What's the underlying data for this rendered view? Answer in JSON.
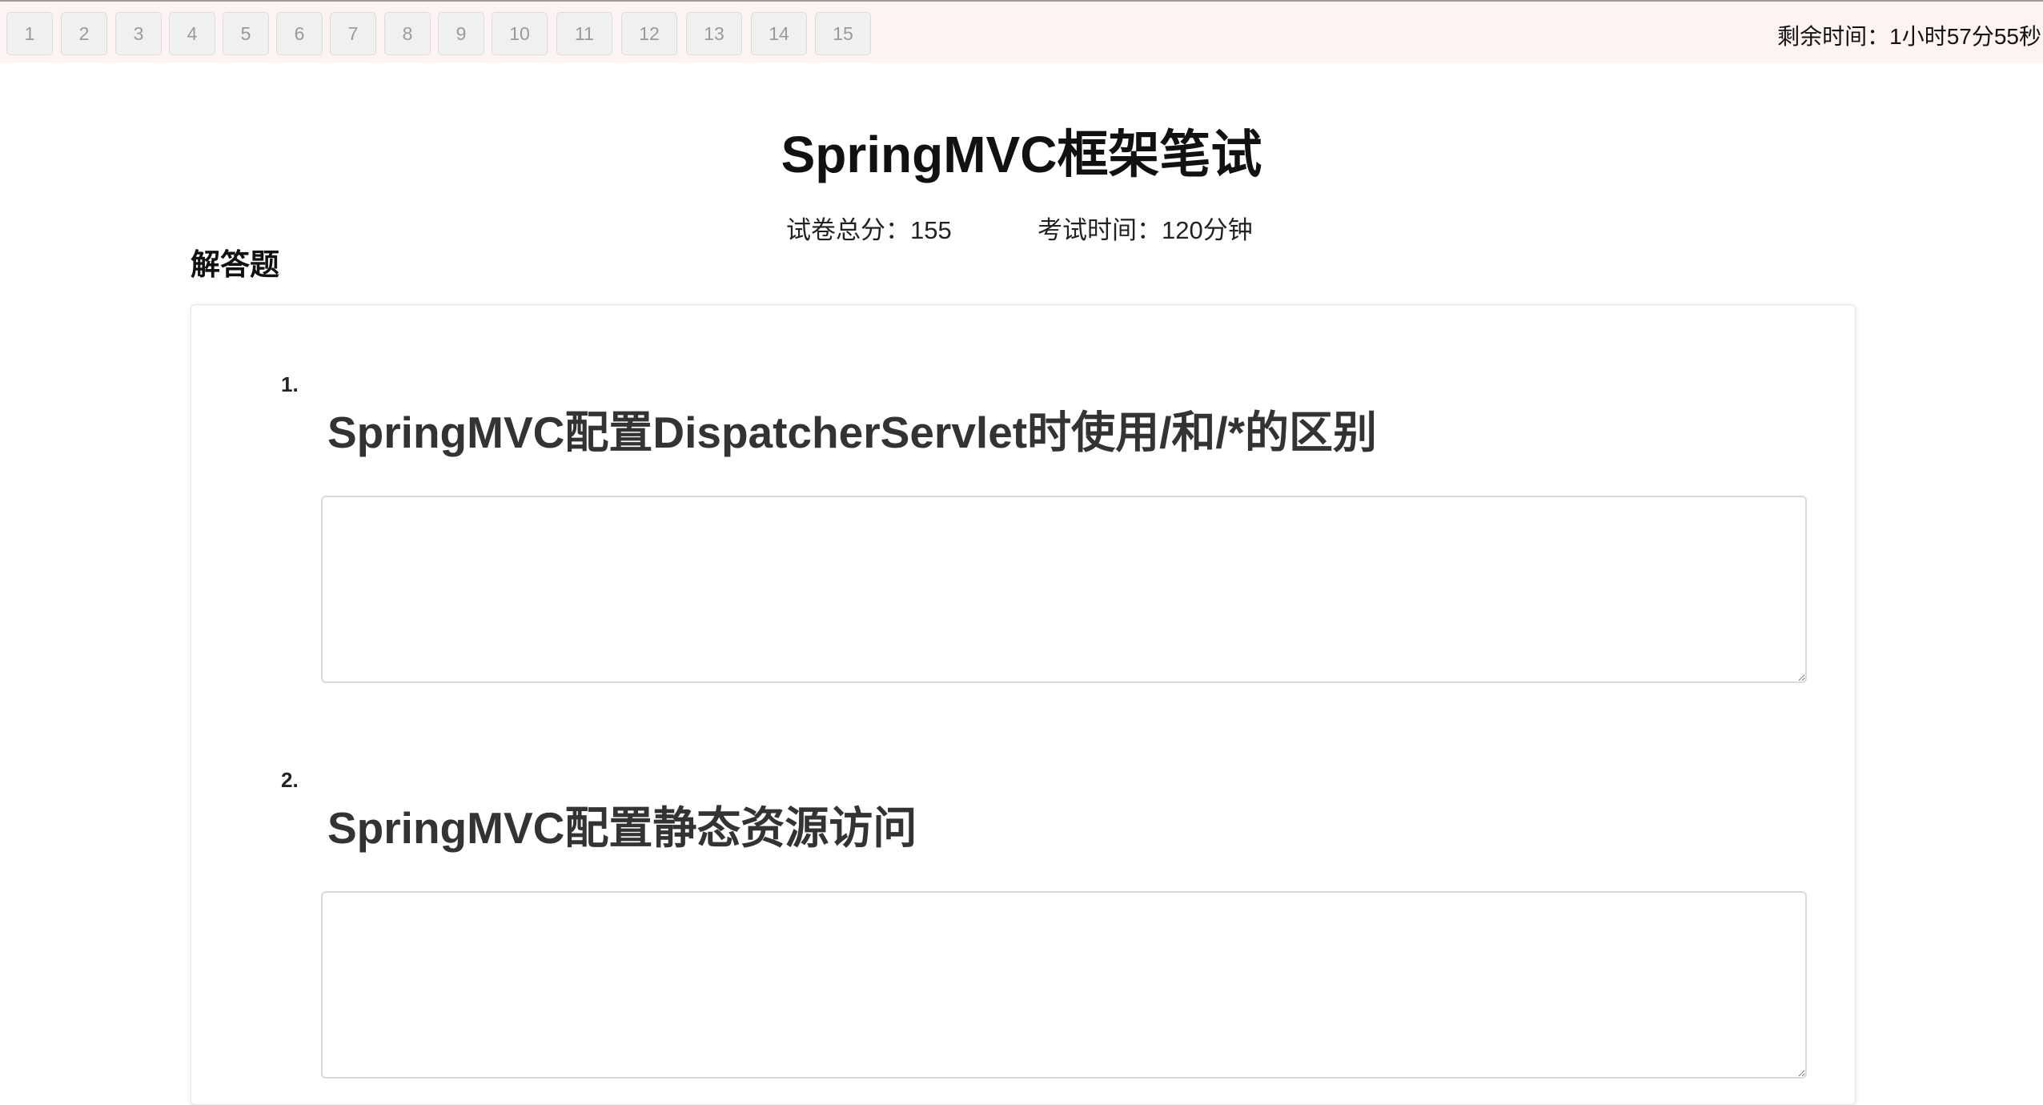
{
  "nav": {
    "question_buttons": [
      "1",
      "2",
      "3",
      "4",
      "5",
      "6",
      "7",
      "8",
      "9",
      "10",
      "11",
      "12",
      "13",
      "14",
      "15"
    ]
  },
  "timer": {
    "text": "剩余时间：1小时57分55秒"
  },
  "exam": {
    "title": "SpringMVC框架笔试",
    "total_score": "试卷总分：155",
    "duration": "考试时间：120分钟"
  },
  "section": {
    "title": "解答题"
  },
  "questions": [
    {
      "number": "1.",
      "text": "SpringMVC配置DispatcherServlet时使用/和/*的区别",
      "answer": ""
    },
    {
      "number": "2.",
      "text": "SpringMVC配置静态资源访问",
      "answer": ""
    }
  ],
  "colors": {
    "topbar_bg": "#fdf3f2",
    "nav_button_bg": "#f0f0f0",
    "nav_button_text": "#9a9a9a"
  }
}
